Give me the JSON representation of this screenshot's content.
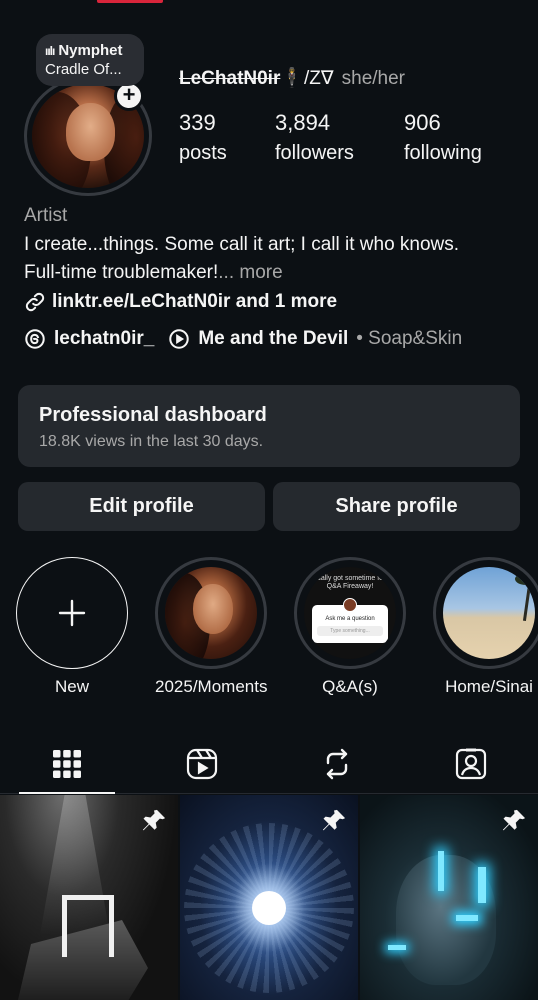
{
  "note": {
    "line1": "Nymphet",
    "line2": "Cradle Of..."
  },
  "profile": {
    "username": "LeChatN0ir",
    "username_suffix": "🕴/Z∇",
    "pronouns": "she/her",
    "stats": [
      {
        "value": "339",
        "label": "posts"
      },
      {
        "value": "3,894",
        "label": "followers"
      },
      {
        "value": "906",
        "label": "following"
      }
    ],
    "category": "Artist",
    "bio_line1": "I create...things. Some call it art; I call it who knows.",
    "bio_line2": "Full-time troublemaker!",
    "more": "... more",
    "link": "linktr.ee/LeChatN0ir and 1 more",
    "threads_handle": "lechatn0ir_",
    "song_title": "Me and the Devil",
    "song_artist": "• Soap&Skin"
  },
  "dashboard": {
    "title": "Professional dashboard",
    "subtitle": "18.8K views in the last 30 days."
  },
  "buttons": {
    "edit": "Edit profile",
    "share": "Share profile"
  },
  "highlights": [
    {
      "label": "New"
    },
    {
      "label": "2025/Moments"
    },
    {
      "label": "Q&A(s)",
      "card_text": "ually got sometime fo Q&A Fireaway!",
      "question": "Ask me a question",
      "placeholder": "Type something..."
    },
    {
      "label": "Home/Sinai"
    }
  ],
  "tabs": [
    "grid-icon",
    "reels-icon",
    "reposts-icon",
    "tagged-icon"
  ],
  "grid": [
    {
      "name": "post-1",
      "pinned": true
    },
    {
      "name": "post-2",
      "pinned": true
    },
    {
      "name": "post-3",
      "pinned": true
    }
  ]
}
